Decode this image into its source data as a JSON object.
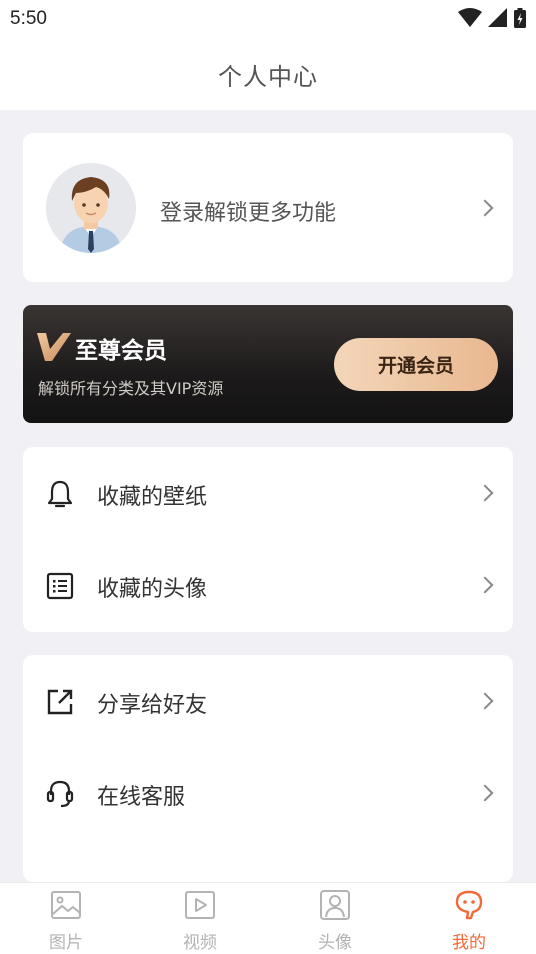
{
  "status": {
    "time": "5:50"
  },
  "header": {
    "title": "个人中心"
  },
  "profile": {
    "login_text": "登录解锁更多功能"
  },
  "vip": {
    "title": "至尊会员",
    "subtitle": "解锁所有分类及其VIP资源",
    "button_label": "开通会员"
  },
  "menu_group_1": [
    {
      "label": "收藏的壁纸",
      "icon": "bell-icon"
    },
    {
      "label": "收藏的头像",
      "icon": "list-icon"
    }
  ],
  "menu_group_2": [
    {
      "label": "分享给好友",
      "icon": "share-icon"
    },
    {
      "label": "在线客服",
      "icon": "headset-icon"
    }
  ],
  "tabs": [
    {
      "label": "图片",
      "icon": "image-icon",
      "active": false
    },
    {
      "label": "视频",
      "icon": "video-icon",
      "active": false
    },
    {
      "label": "头像",
      "icon": "person-icon",
      "active": false
    },
    {
      "label": "我的",
      "icon": "mine-icon",
      "active": true
    }
  ],
  "colors": {
    "accent": "#f26a3a",
    "vip_gold": "#e9b890",
    "background": "#f0f0f5"
  }
}
